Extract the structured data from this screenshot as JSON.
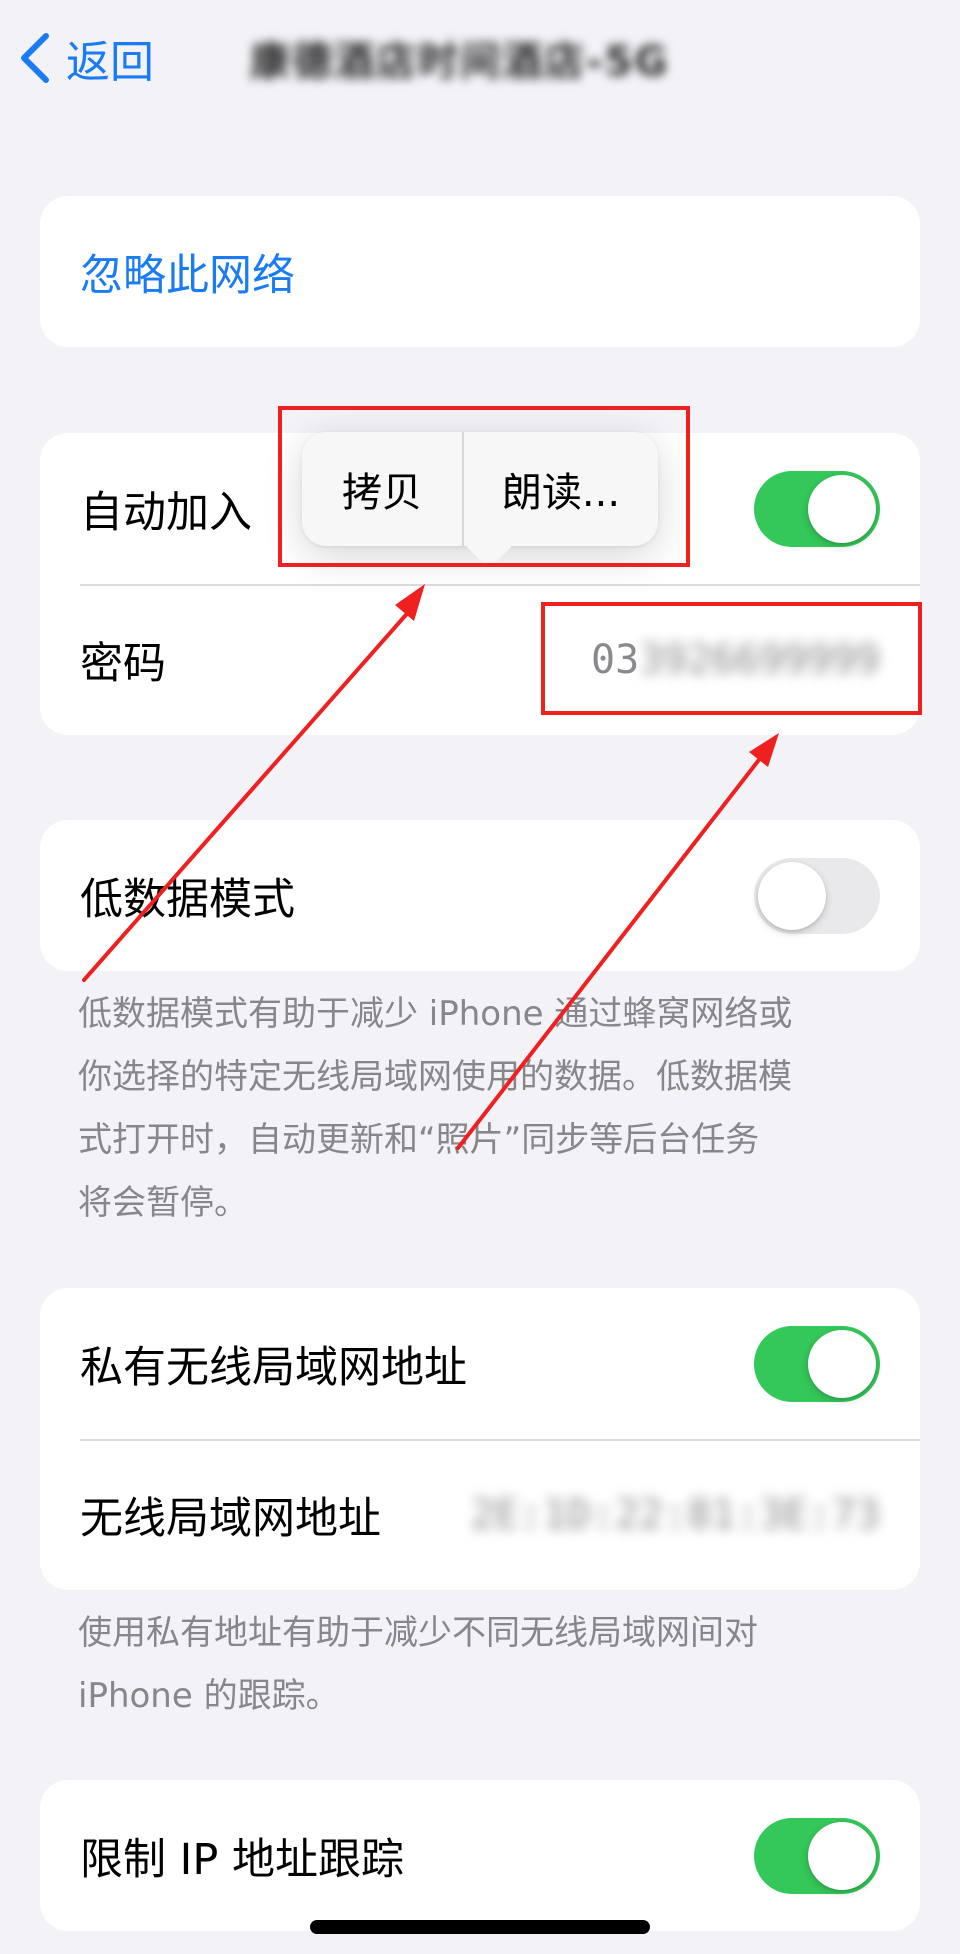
{
  "nav": {
    "back_label": "返回",
    "title": "康德酒店时间酒店-5G"
  },
  "forget": {
    "label": "忽略此网络"
  },
  "auto_join": {
    "label": "自动加入",
    "enabled": true
  },
  "password": {
    "label": "密码",
    "value_visible": "03",
    "value_blurred": "3926699999"
  },
  "context_menu": {
    "copy_label": "拷贝",
    "speak_label": "朗读..."
  },
  "low_data": {
    "label": "低数据模式",
    "enabled": false,
    "footer_lines": [
      "低数据模式有助于减少 iPhone 通过蜂窝网络或",
      "你选择的特定无线局域网使用的数据。低数据模",
      "式打开时，自动更新和“照片”同步等后台任务",
      "将会暂停。"
    ]
  },
  "private_address": {
    "label": "私有无线局域网地址",
    "enabled": true,
    "wifi_address_label": "无线局域网地址",
    "wifi_address_value": "2E:1D:22:81:3E:73",
    "footer_lines": [
      "使用私有地址有助于减少不同无线局域网间对",
      "iPhone 的跟踪。"
    ]
  },
  "limit_ip": {
    "label": "限制 IP 地址跟踪",
    "enabled": true
  },
  "colors": {
    "accent": "#1a7cf5",
    "toggle_on": "#34c759",
    "toggle_off": "#e9e9eb",
    "annotation": "#ee2020",
    "background": "#f2f2f7"
  },
  "icons": {
    "back": "chevron-left-icon"
  }
}
